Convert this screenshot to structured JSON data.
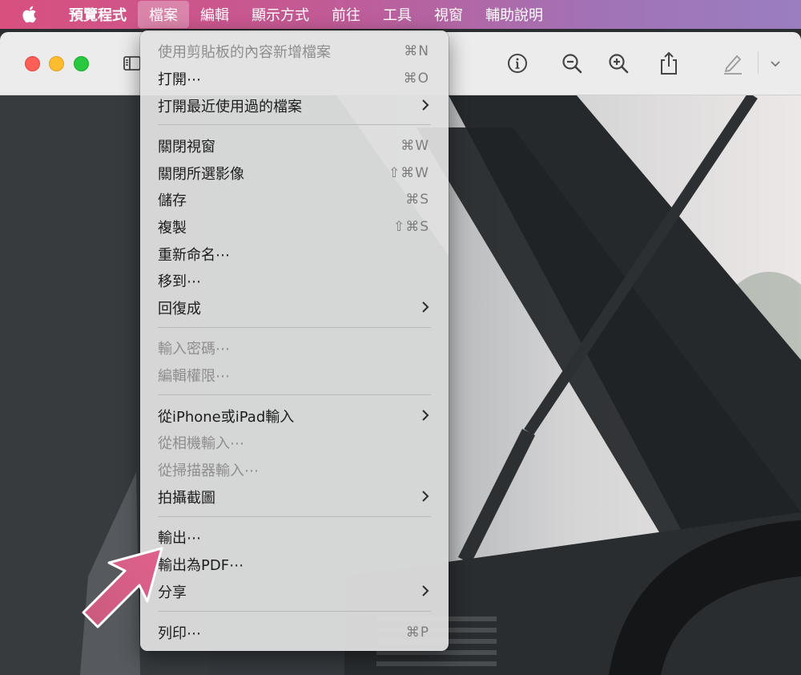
{
  "menubar": {
    "app_name": "預覽程式",
    "items": [
      "檔案",
      "編輯",
      "顯示方式",
      "前往",
      "工具",
      "視窗",
      "輔助說明"
    ]
  },
  "toolbar": {
    "icons": [
      "sidebar-icon",
      "info-icon",
      "zoom-out-icon",
      "zoom-in-icon",
      "share-icon",
      "markup-icon",
      "chevron-down-icon"
    ]
  },
  "file_menu": {
    "new_from_clipboard": {
      "label": "使用剪貼板的內容新增檔案",
      "shortcut": "⌘N"
    },
    "open": {
      "label": "打開⋯",
      "shortcut": "⌘O"
    },
    "open_recent": {
      "label": "打開最近使用過的檔案"
    },
    "close_window": {
      "label": "關閉視窗",
      "shortcut": "⌘W"
    },
    "close_selected": {
      "label": "關閉所選影像",
      "shortcut": "⇧⌘W"
    },
    "save": {
      "label": "儲存",
      "shortcut": "⌘S"
    },
    "duplicate": {
      "label": "複製",
      "shortcut": "⇧⌘S"
    },
    "rename": {
      "label": "重新命名⋯"
    },
    "move_to": {
      "label": "移到⋯"
    },
    "revert_to": {
      "label": "回復成"
    },
    "enter_password": {
      "label": "輸入密碼⋯"
    },
    "edit_permissions": {
      "label": "編輯權限⋯"
    },
    "import_iphone": {
      "label": "從iPhone或iPad輸入"
    },
    "import_camera": {
      "label": "從相機輸入⋯"
    },
    "import_scanner": {
      "label": "從掃描器輸入⋯"
    },
    "screenshot": {
      "label": "拍攝截圖"
    },
    "export": {
      "label": "輸出⋯"
    },
    "export_pdf": {
      "label": "輸出為PDF⋯"
    },
    "share": {
      "label": "分享"
    },
    "print": {
      "label": "列印⋯",
      "shortcut": "⌘P"
    }
  },
  "colors": {
    "menubar_gradient_start": "#d8507e",
    "menubar_gradient_end": "#9a7ec0",
    "pointer_arrow": "#d4587f"
  }
}
